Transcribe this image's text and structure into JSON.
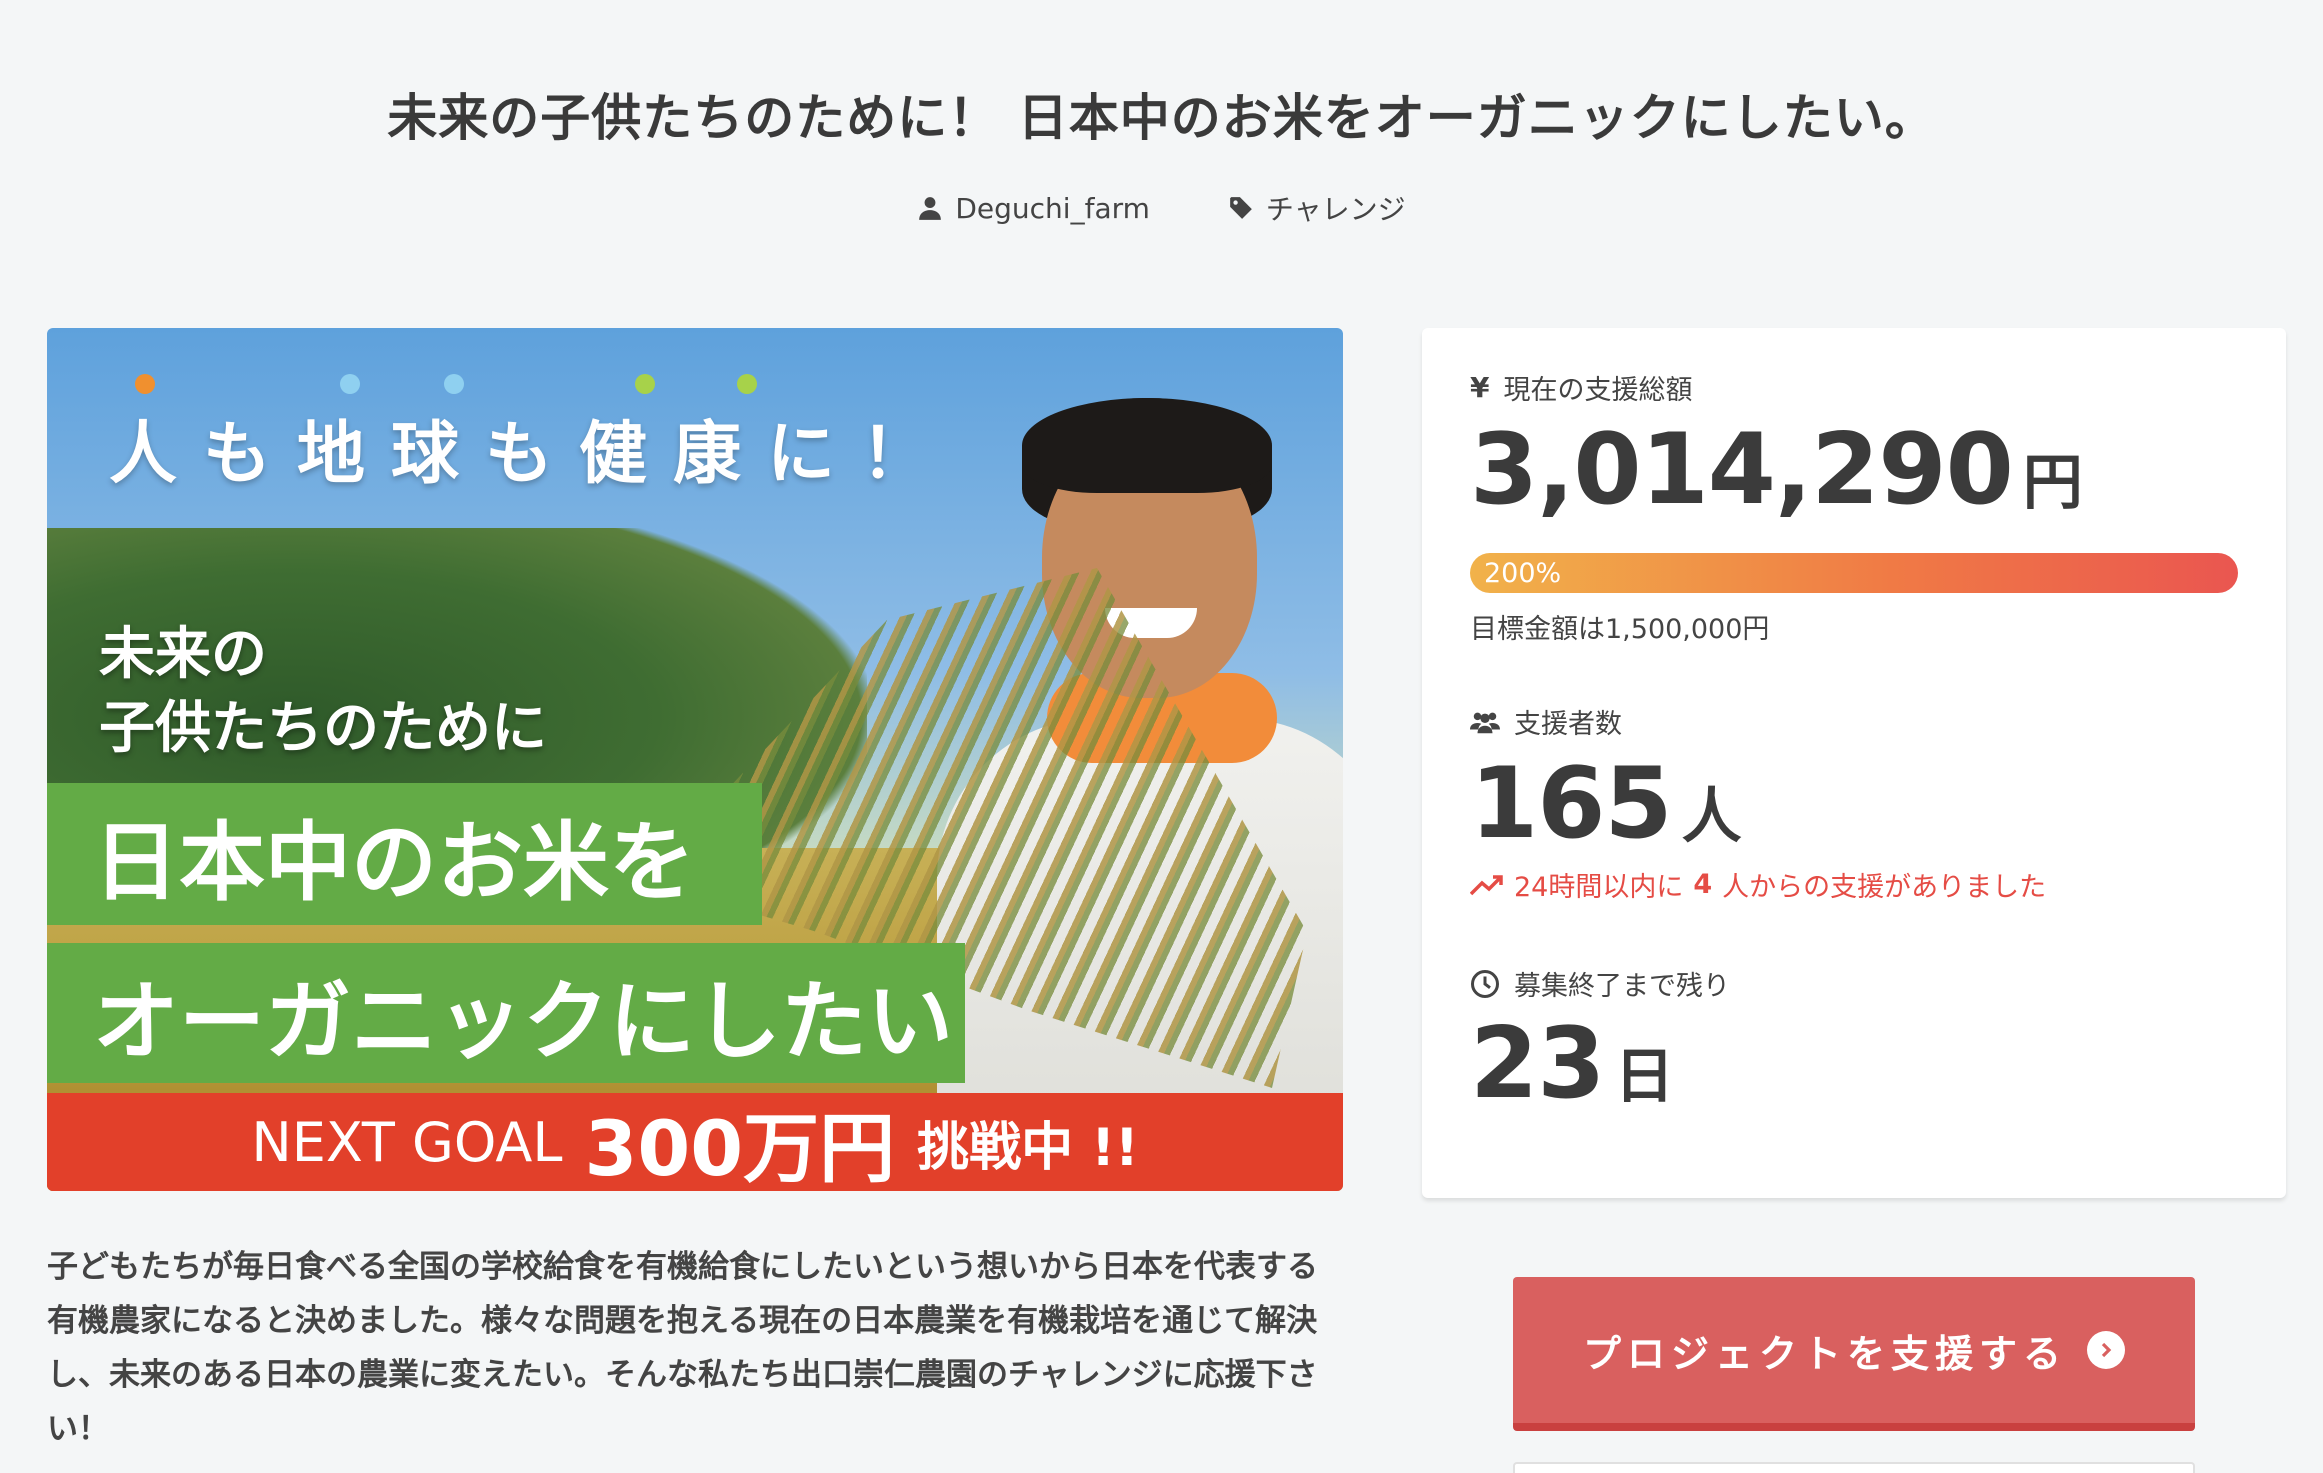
{
  "project": {
    "title": "未来の子供たちのために！ 日本中のお米をオーガニックにしたい。",
    "owner": "Deguchi_farm",
    "category": "チャレンジ"
  },
  "hero": {
    "catch": "人も地球も健康に！",
    "sub_line1": "未来の",
    "sub_line2": "子供たちのために",
    "main_line1": "日本中のお米を",
    "main_line2": "オーガニックにしたい",
    "goal_prefix": "NEXT GOAL",
    "goal_amount": "300万円",
    "goal_suffix": "挑戦中 !!",
    "dot_colors": [
      "#f0902f",
      "#8fd0f0",
      "#8fd0f0",
      "#a7d24a",
      "#a7d24a"
    ]
  },
  "description": "子どもたちが毎日食べる全国の学校給食を有機給食にしたいという想いから日本を代表する有機農家になると決めました。様々な問題を抱える現在の日本農業を有機栽培を通じて解決し、未来のある日本の農業に変えたい。そんな私たち出口崇仁農園のチャレンジに応援下さい！",
  "stats": {
    "total_label": "現在の支援総額",
    "total_amount": "3,014,290",
    "total_unit": "円",
    "progress_label": "200%",
    "progress_fraction": 1.0,
    "goal_text": "目標金額は1,500,000円",
    "supporters_label": "支援者数",
    "supporters_count": "165",
    "supporters_unit": "人",
    "trend_prefix": "24時間以内に",
    "trend_count": "4",
    "trend_suffix": "人からの支援がありました",
    "remaining_label": "募集終了まで残り",
    "remaining_days": "23",
    "remaining_unit": "日"
  },
  "cta": {
    "support_label": "プロジェクトを支援する"
  },
  "colors": {
    "accent": "#d9605f",
    "trend": "#e54c45",
    "banner_green": "#63ab46",
    "banner_red": "#e2402a"
  }
}
